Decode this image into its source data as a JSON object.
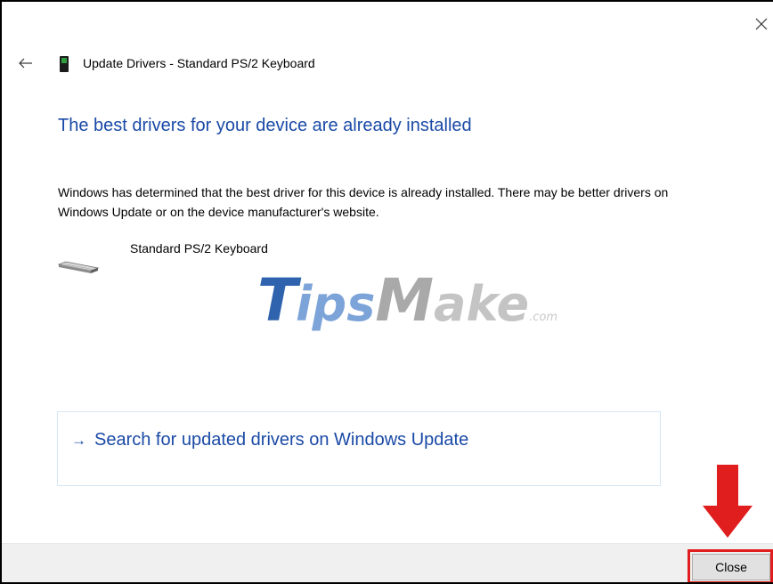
{
  "dialog": {
    "title": "Update Drivers - Standard PS/2 Keyboard",
    "headline": "The best drivers for your device are already installed",
    "description": "Windows has determined that the best driver for this device is already installed. There may be better drivers on Windows Update or on the device manufacturer's website.",
    "device_name": "Standard PS/2 Keyboard"
  },
  "option": {
    "arrow": "→",
    "label": "Search for updated drivers on Windows Update"
  },
  "footer": {
    "close_label": "Close"
  },
  "watermark": {
    "t": "T",
    "ips": "ips",
    "m": "M",
    "ake": "ake",
    "com": ".com"
  },
  "icons": {
    "close": "close-x-icon",
    "back": "back-arrow-icon",
    "device": "device-icon",
    "keyboard": "keyboard-icon",
    "annotation": "red-down-arrow-icon"
  },
  "colors": {
    "accent": "#1a4aa6",
    "footer_bg": "#f0f0f0",
    "annotation_red": "#e01e1e",
    "option_border": "#d6e6f5"
  }
}
